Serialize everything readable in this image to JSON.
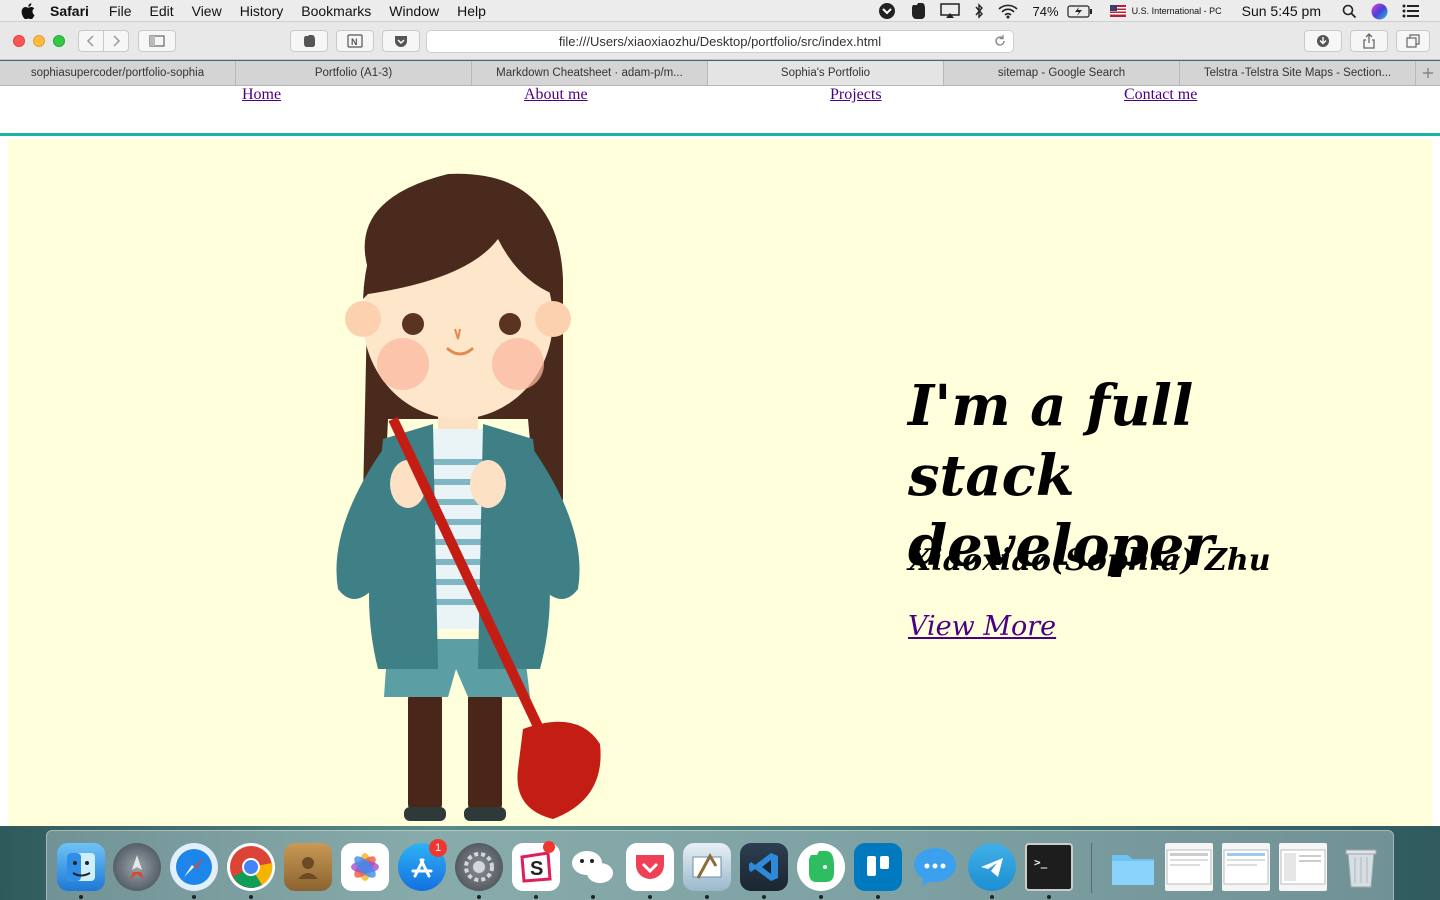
{
  "menubar": {
    "app_name": "Safari",
    "menus": [
      "File",
      "Edit",
      "View",
      "History",
      "Bookmarks",
      "Window",
      "Help"
    ],
    "battery": "74%",
    "input_source": "U.S. International - PC",
    "clock": "Sun 5:45 pm"
  },
  "browser": {
    "url": "file:///Users/xiaoxiaozhu/Desktop/portfolio/src/index.html",
    "tabs": [
      {
        "title": "sophiasupercoder/portfolio-sophia",
        "active": false
      },
      {
        "title": "Portfolio (A1-3)",
        "active": false
      },
      {
        "title": "Markdown Cheatsheet · adam-p/m...",
        "active": false
      },
      {
        "title": "Sophia's Portfolio",
        "active": true
      },
      {
        "title": "sitemap - Google Search",
        "active": false
      },
      {
        "title": "Telstra -Telstra Site Maps - Section...",
        "active": false
      }
    ]
  },
  "site": {
    "nav": {
      "home": "Home",
      "about": "About me",
      "projects": "Projects",
      "contact": "Contact me"
    },
    "hero": {
      "title": "I'm a full stack developer",
      "name": "Xiaoxiao(Sophia) Zhu",
      "cta": "View More"
    },
    "colors": {
      "hero_background": "#ffffdc",
      "nav_border": "#18b1ad",
      "link": "#4b0082"
    }
  },
  "dock": {
    "apps": [
      "finder-icon",
      "launchpad-icon",
      "safari-icon",
      "chrome-icon",
      "contacts-icon",
      "photos-icon",
      "app-store-icon",
      "system-preferences-icon",
      "slack-icon",
      "wechat-icon",
      "pocket-icon",
      "mail-icon",
      "vscode-icon",
      "evernote-icon",
      "trello-icon",
      "messenger-icon",
      "telegram-icon",
      "terminal-icon"
    ],
    "app_store_badge": "1"
  }
}
